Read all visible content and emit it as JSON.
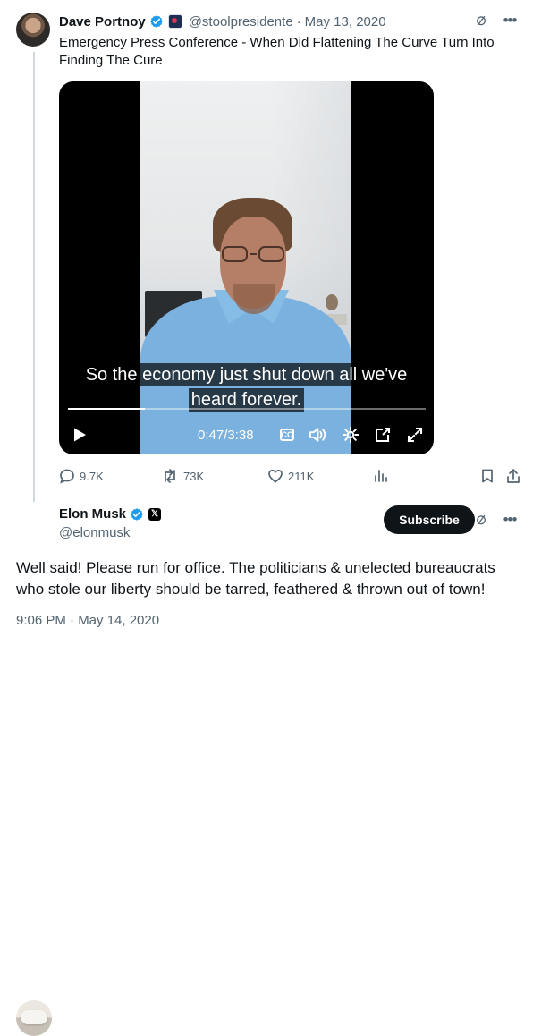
{
  "quoted_tweet": {
    "display_name": "Dave Portnoy",
    "handle": "@stoolpresidente",
    "separator": "·",
    "date": "May 13, 2020",
    "text": "Emergency Press Conference - When Did Flattening The Curve Turn Into Finding The Cure",
    "icons": {
      "verified": "verified-badge-icon",
      "affiliate": "affiliate-badge-icon",
      "hide": "slash-circle-icon",
      "more": "more-icon"
    },
    "video": {
      "caption_lines": [
        "So the economy just shut down all we've",
        "heard forever."
      ],
      "elapsed": "0:47",
      "duration": "3:38",
      "progress_fraction": 0.216,
      "cc_label": "CC",
      "icons": [
        "play-icon",
        "closed-captions-icon",
        "volume-icon",
        "settings-icon",
        "picture-in-picture-icon",
        "fullscreen-icon"
      ]
    },
    "metrics": {
      "replies": "9.7K",
      "reposts": "73K",
      "likes": "211K"
    }
  },
  "reply_tweet": {
    "display_name": "Elon Musk",
    "handle": "@elonmusk",
    "subscribe_label": "Subscribe",
    "x_badge_label": "𝕏",
    "text": "Well said! Please run for office. The politicians & unelected bureaucrats who stole our liberty should be tarred, feathered & thrown out of town!",
    "timestamp": "9:06 PM · May 14, 2020",
    "icons": {
      "verified": "verified-badge-icon",
      "x_badge": "x-logo-icon",
      "hide": "slash-circle-icon",
      "more": "more-icon"
    }
  },
  "colors": {
    "text": "#0f1419",
    "secondary_text": "#536471",
    "verified_blue": "#1d9bf0",
    "thread_line": "#cfd9de",
    "video_background": "#000000",
    "subscribe_background": "#0f1419"
  }
}
